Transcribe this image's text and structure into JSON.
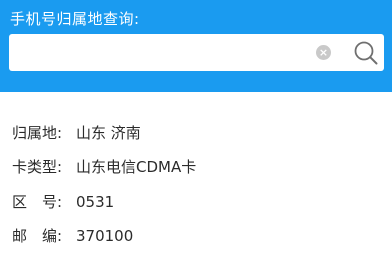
{
  "header": {
    "title": "手机号归属地查询:"
  },
  "search": {
    "placeholder": "",
    "value": ""
  },
  "icons": {
    "clear": "clear-icon",
    "search": "search-icon"
  },
  "result": {
    "location_label": "归属地:",
    "location_value": "山东 济南",
    "card_type_label": "卡类型:",
    "card_type_value": "山东电信CDMA卡",
    "area_code_label": "区　号:",
    "area_code_value": "0531",
    "zip_code_label": "邮　编:",
    "zip_code_value": "370100"
  },
  "colors": {
    "header_bg": "#1a9bf0",
    "text": "#2b2b2b"
  }
}
